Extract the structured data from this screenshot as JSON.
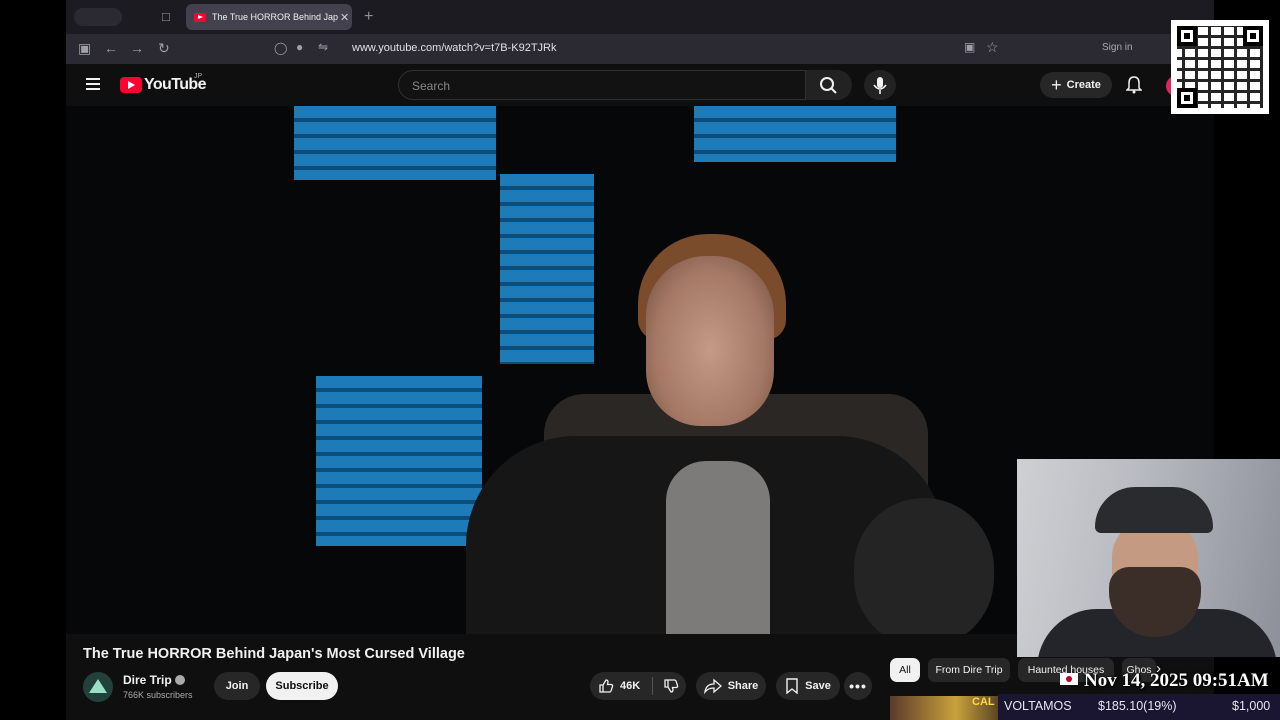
{
  "browser": {
    "tab_title": "The True HORROR Behind Japan's Most Cursed Village",
    "url": "www.youtube.com/watch?v=t7B-K92TJRk",
    "signin_label": "Sign in"
  },
  "youtube": {
    "logo_text": "YouTube",
    "region": "JP",
    "search_placeholder": "Search",
    "create_label": "Create"
  },
  "video": {
    "title": "The True HORROR Behind Japan's Most Cursed Village",
    "channel_name": "Dire Trip",
    "subscribers": "766K subscribers",
    "join_label": "Join",
    "subscribe_label": "Subscribe",
    "likes": "46K",
    "share_label": "Share",
    "save_label": "Save"
  },
  "chips": [
    "All",
    "From Dire Trip",
    "Haunted houses",
    "Ghos"
  ],
  "overlay": {
    "datetime": "Nov 14, 2025 09:51AM",
    "ticker_name": "VOLTAMOS",
    "ticker_amount": "$185.10(19%)",
    "ticker_goal": "$1,000",
    "thumb_text": "CAL"
  },
  "colors": {
    "youtube_red": "#ff0033",
    "bg_dark": "#0f0f0f",
    "subscribe_bg": "#f1f1f1"
  }
}
